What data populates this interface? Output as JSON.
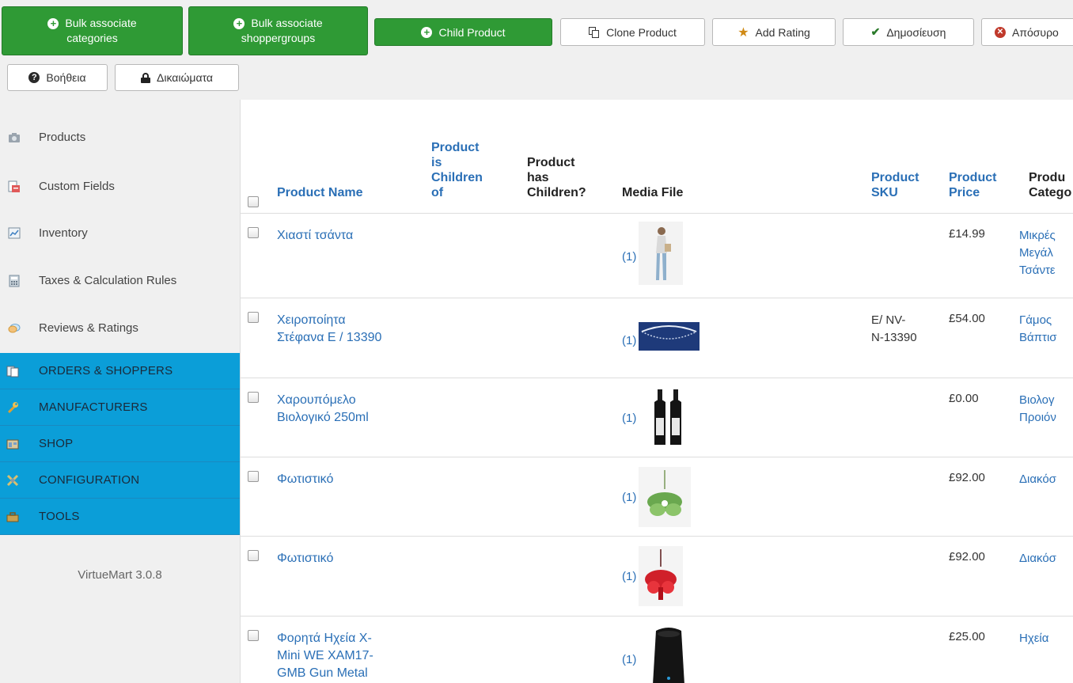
{
  "toolbar": {
    "bulk_categories": [
      "Bulk associate",
      "categories"
    ],
    "bulk_shoppergroups": [
      "Bulk associate",
      "shoppergroups"
    ],
    "child_product": "Child Product",
    "clone_product": "Clone Product",
    "add_rating": "Add Rating",
    "publish": "Δημοσίευση",
    "unpublish": "Απόσυρο",
    "help": "Βοήθεια",
    "permissions": "Δικαιώματα"
  },
  "sidebar": {
    "items": [
      {
        "label": "Products",
        "icon": "camera-icon"
      },
      {
        "label": "Custom Fields",
        "icon": "custom-fields-icon"
      },
      {
        "label": "Inventory",
        "icon": "inventory-chart-icon"
      },
      {
        "label": "Taxes & Calculation Rules",
        "icon": "calculator-icon"
      },
      {
        "label": "Reviews & Ratings",
        "icon": "speech-bubble-icon"
      }
    ],
    "categories": [
      {
        "label": "ORDERS & SHOPPERS",
        "icon": "orders-icon"
      },
      {
        "label": "MANUFACTURERS",
        "icon": "wrench-icon"
      },
      {
        "label": "SHOP",
        "icon": "shop-icon"
      },
      {
        "label": "CONFIGURATION",
        "icon": "configuration-icon"
      },
      {
        "label": "TOOLS",
        "icon": "tools-box-icon"
      }
    ],
    "version": "VirtueMart 3.0.8"
  },
  "table": {
    "headers": {
      "product_name": "Product Name",
      "is_children_of": [
        "Product",
        "is",
        "Children",
        "of"
      ],
      "has_children": [
        "Product",
        "has",
        "Children?"
      ],
      "media_file": "Media File",
      "sku": [
        "Product",
        "SKU"
      ],
      "price": [
        "Product",
        "Price"
      ],
      "category": [
        "Produ",
        "Catego"
      ]
    },
    "rows": [
      {
        "name": [
          "Χιαστί τσάντα"
        ],
        "media_count": "(1)",
        "sku": [],
        "price": "£14.99",
        "category": [
          "Μικρές",
          "Μεγάλ",
          "Τσάντε"
        ],
        "thumb": "model-photo"
      },
      {
        "name": [
          "Χειροποίητα",
          "Στέφανα Ε / 13390"
        ],
        "media_count": "(1)",
        "sku": [
          "E/ NV-",
          "N-13390"
        ],
        "price": "£54.00",
        "category": [
          "Γάμος",
          "Βάπτισ"
        ],
        "thumb": "wreath-photo"
      },
      {
        "name": [
          "Χαρουπόμελο",
          "Βιολογικό 250ml"
        ],
        "media_count": "(1)",
        "sku": [],
        "price": "£0.00",
        "category": [
          "Βιολογ",
          "Προιόν"
        ],
        "thumb": "bottles-photo"
      },
      {
        "name": [
          "Φωτιστικό"
        ],
        "media_count": "(1)",
        "sku": [],
        "price": "£92.00",
        "category": [
          "Διακόσ"
        ],
        "thumb": "green-chandelier-photo"
      },
      {
        "name": [
          "Φωτιστικό"
        ],
        "media_count": "(1)",
        "sku": [],
        "price": "£92.00",
        "category": [
          "Διακόσ"
        ],
        "thumb": "red-chandelier-photo"
      },
      {
        "name": [
          "Φορητά Ηχεία X-",
          "Mini WE XAM17-",
          "GMB Gun Metal"
        ],
        "media_count": "(1)",
        "sku": [],
        "price": "£25.00",
        "category": [
          "Ηχεία"
        ],
        "thumb": "speaker-photo"
      }
    ]
  }
}
